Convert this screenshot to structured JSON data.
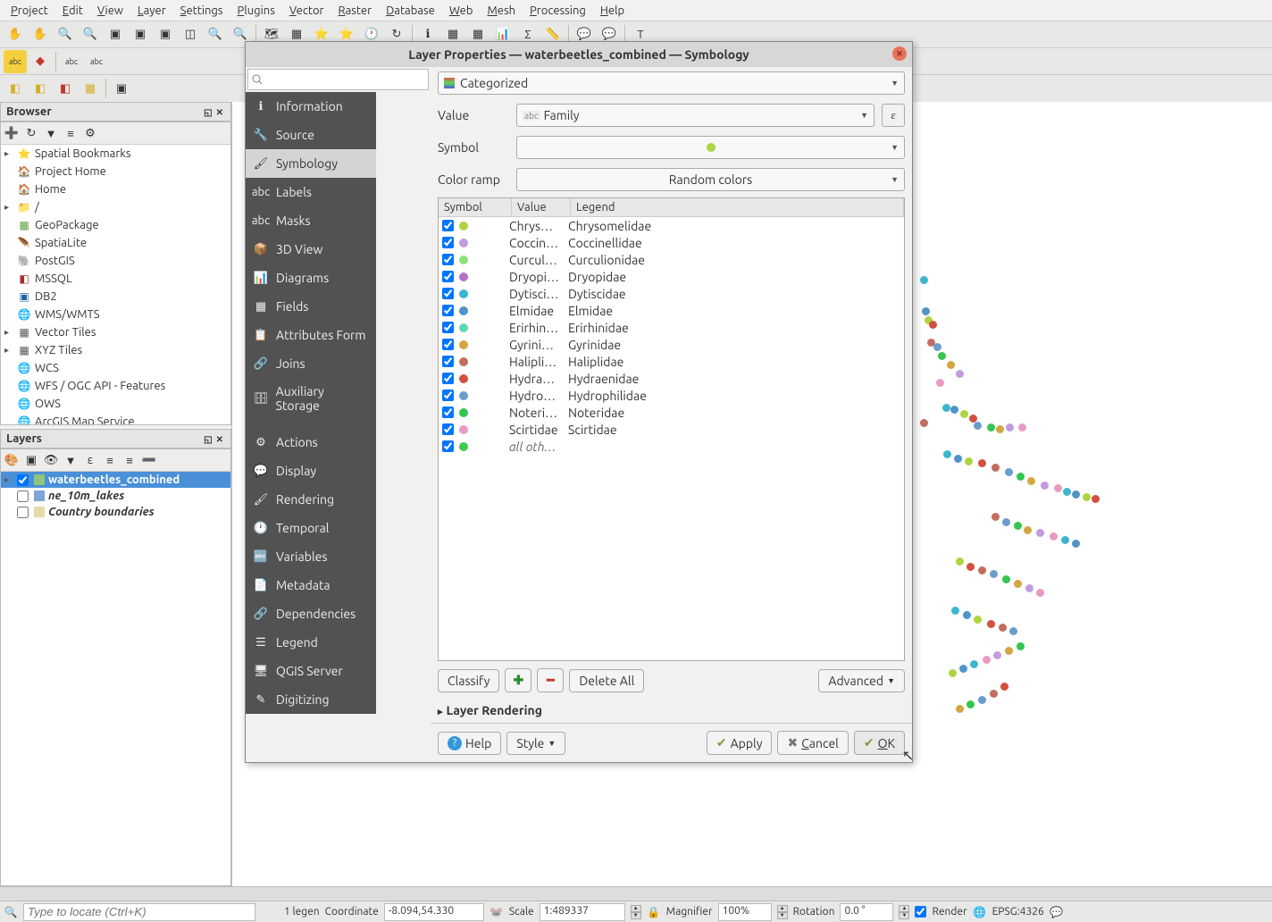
{
  "menubar": [
    "Project",
    "Edit",
    "View",
    "Layer",
    "Settings",
    "Plugins",
    "Vector",
    "Raster",
    "Database",
    "Web",
    "Mesh",
    "Processing",
    "Help"
  ],
  "browser": {
    "title": "Browser",
    "items": [
      {
        "icon": "⭐",
        "label": "Spatial Bookmarks",
        "expandable": true
      },
      {
        "icon": "🏠",
        "label": "Project Home",
        "color": "#5a9e3f"
      },
      {
        "icon": "🏠",
        "label": "Home",
        "color": "#5a9e3f"
      },
      {
        "icon": "📁",
        "label": "/",
        "expandable": true
      },
      {
        "icon": "▦",
        "label": "GeoPackage",
        "color": "#5a9e3f"
      },
      {
        "icon": "🪶",
        "label": "SpatiaLite"
      },
      {
        "icon": "🐘",
        "label": "PostGIS",
        "color": "#4a6ea0"
      },
      {
        "icon": "◧",
        "label": "MSSQL",
        "color": "#a03030"
      },
      {
        "icon": "▣",
        "label": "DB2",
        "color": "#2060a0"
      },
      {
        "icon": "🌐",
        "label": "WMS/WMTS",
        "color": "#4a9e5f"
      },
      {
        "icon": "▦",
        "label": "Vector Tiles",
        "expandable": true
      },
      {
        "icon": "▦",
        "label": "XYZ Tiles",
        "expandable": true
      },
      {
        "icon": "🌐",
        "label": "WCS",
        "color": "#4a9e5f"
      },
      {
        "icon": "🌐",
        "label": "WFS / OGC API - Features",
        "color": "#4a9e5f"
      },
      {
        "icon": "🌐",
        "label": "OWS",
        "color": "#4a9e5f"
      },
      {
        "icon": "🌐",
        "label": "ArcGIS Map Service",
        "color": "#4a9e5f"
      }
    ]
  },
  "layers": {
    "title": "Layers",
    "items": [
      {
        "checked": true,
        "color": "#8ec57d",
        "label": "waterbeetles_combined",
        "selected": true,
        "expandable": true
      },
      {
        "checked": false,
        "color": "#7ea5d6",
        "label": "ne_10m_lakes",
        "italic": true
      },
      {
        "checked": false,
        "color": "#e5dba6",
        "label": "Country boundaries",
        "italic": true
      }
    ]
  },
  "dialog": {
    "title": "Layer Properties — waterbeetles_combined — Symbology",
    "sidebar": [
      {
        "icon": "ℹ",
        "label": "Information",
        "bg": "#3498db"
      },
      {
        "icon": "🔧",
        "label": "Source"
      },
      {
        "icon": "🖌",
        "label": "Symbology",
        "active": true,
        "bg": "#d4d4d4"
      },
      {
        "icon": "abc",
        "label": "Labels",
        "bg": "#f4d03f"
      },
      {
        "icon": "abc",
        "label": "Masks"
      },
      {
        "icon": "📦",
        "label": "3D View"
      },
      {
        "icon": "📊",
        "label": "Diagrams"
      },
      {
        "icon": "▦",
        "label": "Fields"
      },
      {
        "icon": "📋",
        "label": "Attributes Form"
      },
      {
        "icon": "🔗",
        "label": "Joins"
      },
      {
        "icon": "🗄",
        "label": "Auxiliary Storage"
      },
      {
        "sep": true
      },
      {
        "icon": "⚙",
        "label": "Actions"
      },
      {
        "icon": "💬",
        "label": "Display"
      },
      {
        "icon": "🖌",
        "label": "Rendering"
      },
      {
        "icon": "🕐",
        "label": "Temporal"
      },
      {
        "icon": "🔤",
        "label": "Variables"
      },
      {
        "icon": "📄",
        "label": "Metadata"
      },
      {
        "icon": "🔗",
        "label": "Dependencies"
      },
      {
        "icon": "☰",
        "label": "Legend"
      },
      {
        "icon": "🖥",
        "label": "QGIS Server"
      },
      {
        "icon": "✎",
        "label": "Digitizing"
      }
    ],
    "renderer": "Categorized",
    "value_label": "Value",
    "value_field": "Family",
    "symbol_label": "Symbol",
    "colorramp_label": "Color ramp",
    "colorramp": "Random colors",
    "table_headers": [
      "Symbol",
      "Value",
      "Legend"
    ],
    "categories": [
      {
        "color": "#aed441",
        "value": "Chrys…",
        "legend": "Chrysomelidae"
      },
      {
        "color": "#c39bdf",
        "value": "Coccin…",
        "legend": "Coccinellidae"
      },
      {
        "color": "#8ee07a",
        "value": "Curcul…",
        "legend": "Curculionidae"
      },
      {
        "color": "#b76fc8",
        "value": "Dryopi…",
        "legend": "Dryopidae"
      },
      {
        "color": "#3cb6cf",
        "value": "Dytisci…",
        "legend": "Dytiscidae"
      },
      {
        "color": "#4e94c8",
        "value": "Elmidae",
        "legend": "Elmidae"
      },
      {
        "color": "#5fd9b5",
        "value": "Erirhin…",
        "legend": "Erirhinidae"
      },
      {
        "color": "#d3a640",
        "value": "Gyrini…",
        "legend": "Gyrinidae"
      },
      {
        "color": "#c16e5f",
        "value": "Halipli…",
        "legend": "Haliplidae"
      },
      {
        "color": "#d2503e",
        "value": "Hydra…",
        "legend": "Hydraenidae"
      },
      {
        "color": "#6b9dcc",
        "value": "Hydro…",
        "legend": "Hydrophilidae"
      },
      {
        "color": "#35c551",
        "value": "Noteri…",
        "legend": "Noteridae"
      },
      {
        "color": "#e79bc2",
        "value": "Scirtidae",
        "legend": "Scirtidae"
      },
      {
        "color": "#3cc94f",
        "value": "all oth…",
        "legend": "",
        "allother": true
      }
    ],
    "classify": "Classify",
    "delete_all": "Delete All",
    "advanced": "Advanced",
    "layer_rendering": "Layer Rendering",
    "help": "Help",
    "style": "Style",
    "apply": "Apply",
    "cancel": "Cancel",
    "ok": "OK"
  },
  "statusbar": {
    "locator_placeholder": "Type to locate (Ctrl+K)",
    "legend": "1 legen",
    "coord_label": "Coordinate",
    "coord": "-8.094,54.330",
    "scale_label": "Scale",
    "scale": "1:489337",
    "mag_label": "Magnifier",
    "mag": "100%",
    "rot_label": "Rotation",
    "rot": "0.0 °",
    "render": "Render",
    "crs": "EPSG:4326"
  }
}
